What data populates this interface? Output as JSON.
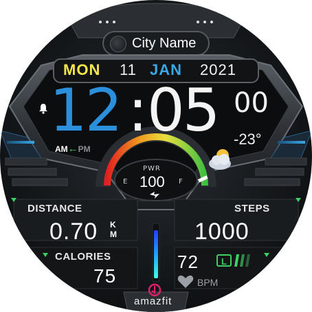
{
  "header": {
    "city": "City Name"
  },
  "date": {
    "weekday": "MON",
    "day": "11",
    "month": "JAN",
    "year": "2021"
  },
  "time": {
    "hours": "12",
    "separator": ":",
    "minutes": "05",
    "seconds": "00",
    "am": "AM",
    "pm": "PM",
    "active_period": "AM"
  },
  "weather": {
    "temperature": "-23°",
    "icon": "partly-cloudy-icon"
  },
  "power": {
    "label": "PWR",
    "value": "100",
    "empty_label": "E",
    "full_label": "F",
    "level_percent": 100
  },
  "distance": {
    "label": "DISTANCE",
    "value": "0.70",
    "unit_line1": "K",
    "unit_line2": "M"
  },
  "steps": {
    "label": "STEPS",
    "value": "1000"
  },
  "calories": {
    "label": "CALORIES",
    "value": "75"
  },
  "heart_rate": {
    "value": "72",
    "zone": "L",
    "unit": "BPM"
  },
  "brand": {
    "name": "amazfit"
  },
  "colors": {
    "accent_blue": "#2b8fdc",
    "weekday_yellow": "#f2e64a",
    "month_blue": "#3aa7e6",
    "status_green": "#3bd163"
  }
}
